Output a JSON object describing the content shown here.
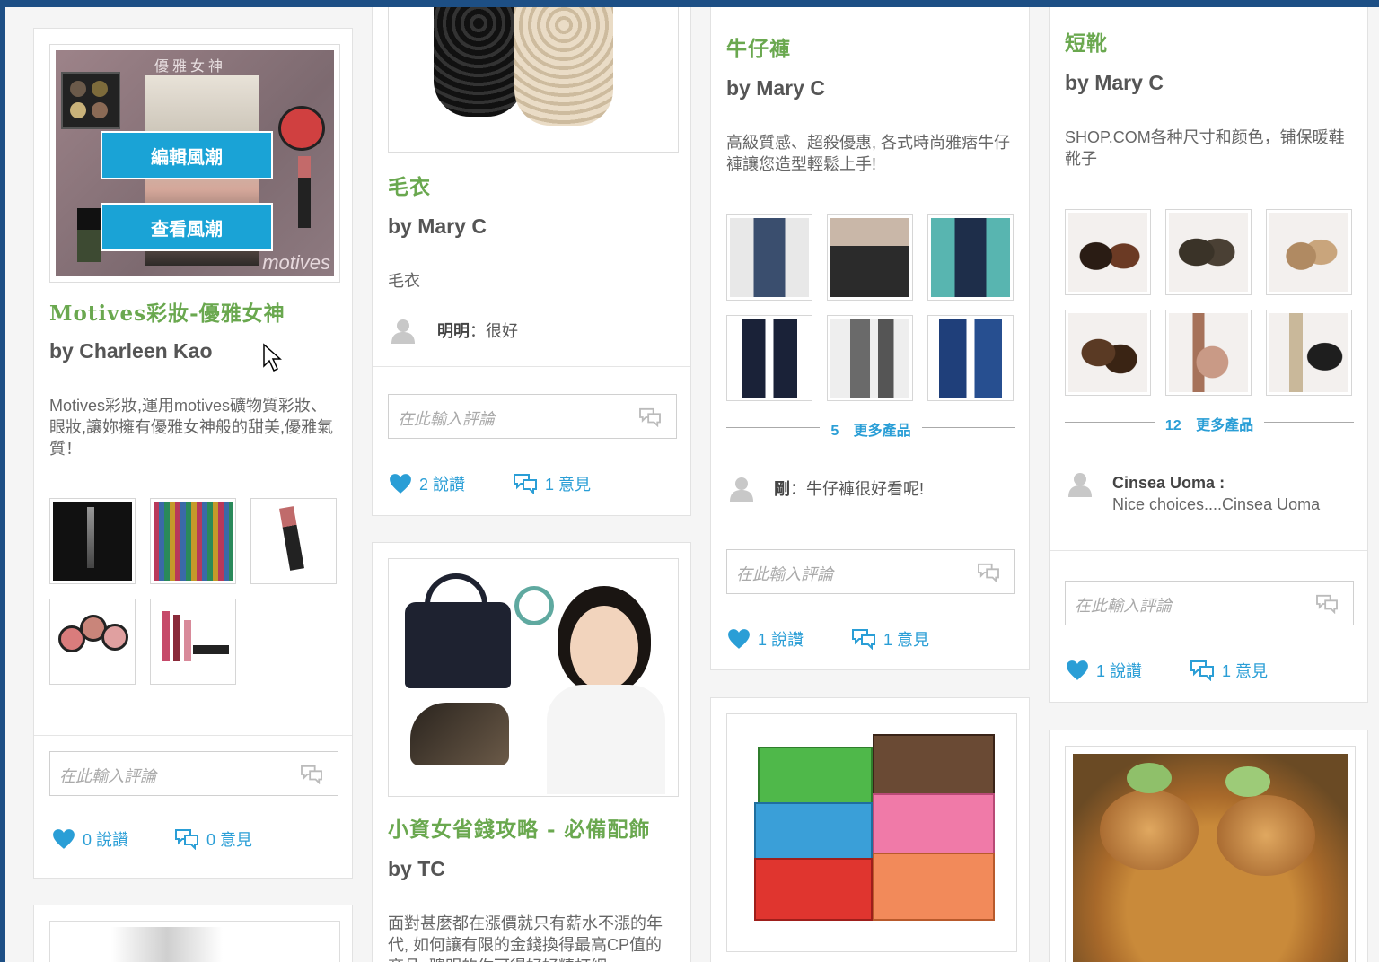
{
  "colors": {
    "frame": "#1d4f85",
    "title_green": "#6aa84f",
    "action_blue": "#2a9ed6",
    "overlay_button": "#1aa3d6"
  },
  "col1": {
    "card1": {
      "cover_title": "優雅女神",
      "cover_brand": "motives",
      "edit_button": "編輯風潮",
      "view_button": "查看風潮",
      "title": "Motives彩妝-優雅女神",
      "by": "by Charleen Kao",
      "desc": "Motives彩妝,運用motives礦物質彩妝、眼妝,讓妳擁有優雅女神般的甜美,優雅氣質！",
      "comment_placeholder": "在此輸入評論",
      "likes": "0 說讚",
      "opinions": "0 意見"
    }
  },
  "col2": {
    "card1": {
      "title": "毛衣",
      "by": "by Mary C",
      "desc": "毛衣",
      "comment_user": "明明",
      "comment_text": "：很好",
      "comment_placeholder": "在此輸入評論",
      "likes": "2 說讚",
      "opinions": "1 意見"
    },
    "card2": {
      "title": "小資女省錢攻略 - 必備配飾",
      "by": "by TC",
      "desc": "面對甚麼都在漲價就只有薪水不漲的年代, 如何讓有限的金錢換得最高CP值的商品, 聰明的你可得好好精打細"
    }
  },
  "col3": {
    "card1": {
      "title": "牛仔褲",
      "by": "by Mary C",
      "desc": "高級質感、超殺優惠, 各式時尚雅痞牛仔褲讓您造型輕鬆上手!",
      "more_count": "5",
      "more_label": "更多產品",
      "comment_user": "剛",
      "comment_text": "：牛仔褲很好看呢!",
      "comment_placeholder": "在此輸入評論",
      "likes": "1 說讚",
      "opinions": "1 意見"
    }
  },
  "col4": {
    "card1": {
      "title": "短靴",
      "by": "by Mary C",
      "desc": "SHOP.COM各种尺寸和颜色，铺保暖鞋靴子",
      "more_count": "12",
      "more_label": "更多產品",
      "comment_user": "Cinsea Uoma",
      "comment_text": "Nice choices....Cinsea Uoma",
      "comment_placeholder": "在此輸入評論",
      "likes": "1 說讚",
      "opinions": "1 意見"
    }
  }
}
